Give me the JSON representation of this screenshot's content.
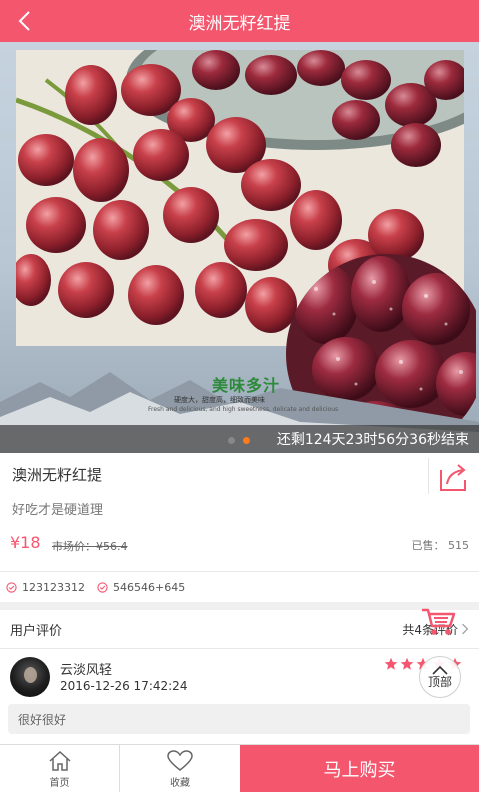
{
  "header": {
    "title": "澳洲无籽红提",
    "back_icon": "chevron-left-icon"
  },
  "banner": {
    "caption": "美味多汁",
    "caption_sub": "硬度大，甜度高，细致而美味",
    "caption_sub2": "Fresh and delicious, and high sweetness, delicate and delicious",
    "countdown": "还剩124天23时56分36秒结束",
    "slide_total": 2,
    "slide_active": 2
  },
  "product": {
    "name": "澳洲无籽红提",
    "slogan": "好吃才是硬道理",
    "price": "¥18",
    "market_price": "市场价：¥56.4",
    "sold": "已售： 515",
    "share_icon": "share-icon"
  },
  "tags": [
    {
      "text": "123123312",
      "icon": "check-circle-icon"
    },
    {
      "text": "546546+645",
      "icon": "check-circle-icon"
    }
  ],
  "reviews": {
    "label": "用户评价",
    "count": "共4条评价",
    "items": [
      {
        "user": "云淡风轻",
        "time": "2016-12-26 17:42:24",
        "rating": 5,
        "comment": "很好很好"
      }
    ]
  },
  "floating": {
    "top_label": "顶部",
    "cart_icon": "cart-icon",
    "top_icon": "chevron-up-icon"
  },
  "bottom_nav": {
    "home_label": "首页",
    "favorite_label": "收藏",
    "buy_label": "马上购买"
  },
  "colors": {
    "accent": "#f4566e",
    "countdown_bar": "#3c3c3c",
    "active_dot": "#ff7a1a"
  }
}
